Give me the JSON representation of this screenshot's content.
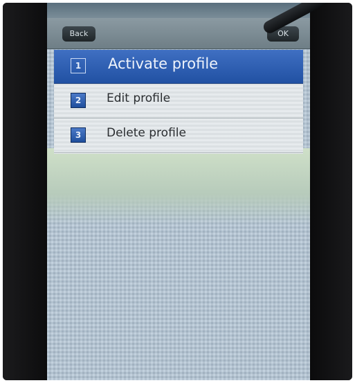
{
  "status_bar": {
    "text": ""
  },
  "title_bar": {
    "back_label": "Back",
    "title": "",
    "ok_label": "OK"
  },
  "menu": {
    "items": [
      {
        "number": "1",
        "label": "Activate profile",
        "selected": true
      },
      {
        "number": "2",
        "label": "Edit profile",
        "selected": false
      },
      {
        "number": "3",
        "label": "Delete profile",
        "selected": false
      }
    ]
  },
  "colors": {
    "selected_bg": "#2f5fb3",
    "menu_bg": "#e2e7ea",
    "badge": "#2f5fb3",
    "screen_bg": "#b4c6d6"
  }
}
